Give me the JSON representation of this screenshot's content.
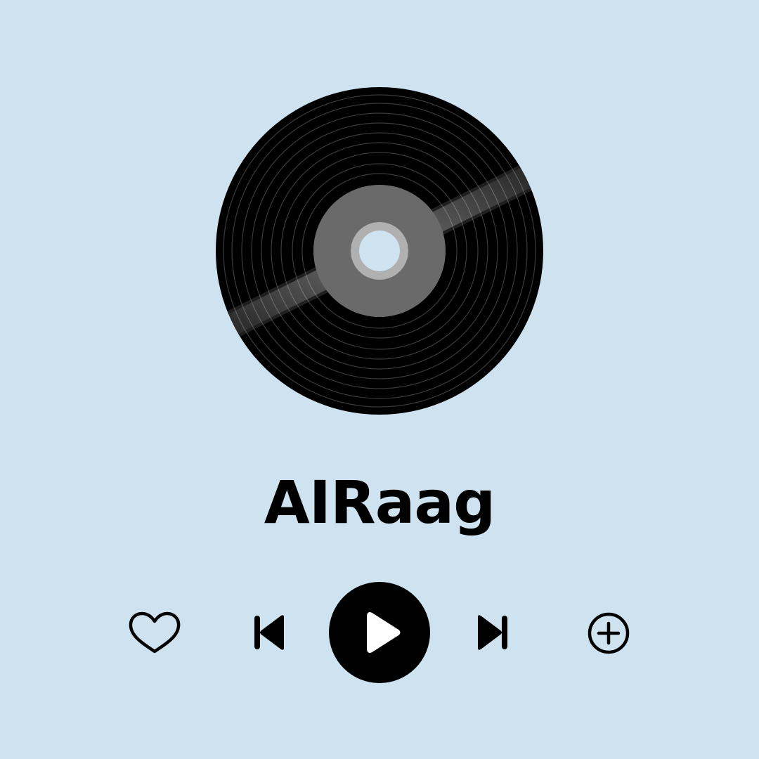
{
  "app": {
    "background_color": "#cfe2ef",
    "accent_color": "#000000"
  },
  "album_art": {
    "icon": "vinyl-record-icon",
    "label_color": "#6a6a6a",
    "hole_ring_color": "#b0b0b0"
  },
  "track": {
    "title": "AIRaag"
  },
  "controls": {
    "like_icon": "heart-outline-icon",
    "previous_icon": "skip-previous-icon",
    "play_icon": "play-icon",
    "next_icon": "skip-next-icon",
    "add_icon": "plus-circle-icon"
  }
}
